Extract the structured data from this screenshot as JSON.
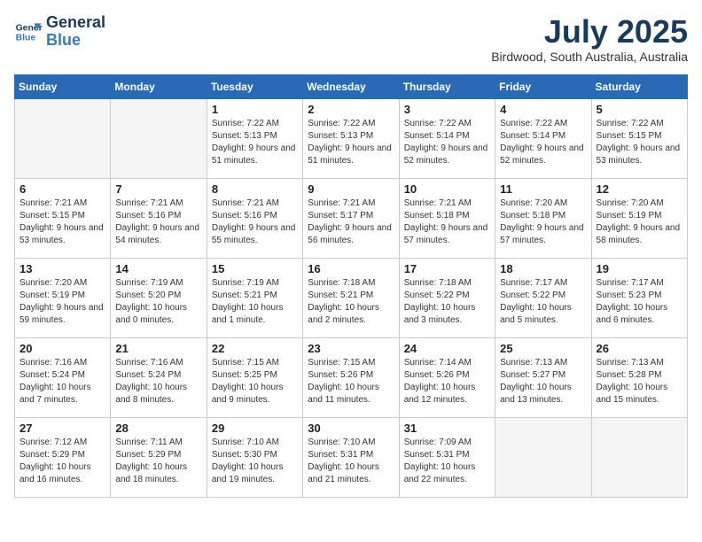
{
  "header": {
    "logo_line1": "General",
    "logo_line2": "Blue",
    "month_title": "July 2025",
    "location": "Birdwood, South Australia, Australia"
  },
  "days_of_week": [
    "Sunday",
    "Monday",
    "Tuesday",
    "Wednesday",
    "Thursday",
    "Friday",
    "Saturday"
  ],
  "weeks": [
    [
      {
        "day": "",
        "content": ""
      },
      {
        "day": "",
        "content": ""
      },
      {
        "day": "1",
        "content": "Sunrise: 7:22 AM\nSunset: 5:13 PM\nDaylight: 9 hours and 51 minutes."
      },
      {
        "day": "2",
        "content": "Sunrise: 7:22 AM\nSunset: 5:13 PM\nDaylight: 9 hours and 51 minutes."
      },
      {
        "day": "3",
        "content": "Sunrise: 7:22 AM\nSunset: 5:14 PM\nDaylight: 9 hours and 52 minutes."
      },
      {
        "day": "4",
        "content": "Sunrise: 7:22 AM\nSunset: 5:14 PM\nDaylight: 9 hours and 52 minutes."
      },
      {
        "day": "5",
        "content": "Sunrise: 7:22 AM\nSunset: 5:15 PM\nDaylight: 9 hours and 53 minutes."
      }
    ],
    [
      {
        "day": "6",
        "content": "Sunrise: 7:21 AM\nSunset: 5:15 PM\nDaylight: 9 hours and 53 minutes."
      },
      {
        "day": "7",
        "content": "Sunrise: 7:21 AM\nSunset: 5:16 PM\nDaylight: 9 hours and 54 minutes."
      },
      {
        "day": "8",
        "content": "Sunrise: 7:21 AM\nSunset: 5:16 PM\nDaylight: 9 hours and 55 minutes."
      },
      {
        "day": "9",
        "content": "Sunrise: 7:21 AM\nSunset: 5:17 PM\nDaylight: 9 hours and 56 minutes."
      },
      {
        "day": "10",
        "content": "Sunrise: 7:21 AM\nSunset: 5:18 PM\nDaylight: 9 hours and 57 minutes."
      },
      {
        "day": "11",
        "content": "Sunrise: 7:20 AM\nSunset: 5:18 PM\nDaylight: 9 hours and 57 minutes."
      },
      {
        "day": "12",
        "content": "Sunrise: 7:20 AM\nSunset: 5:19 PM\nDaylight: 9 hours and 58 minutes."
      }
    ],
    [
      {
        "day": "13",
        "content": "Sunrise: 7:20 AM\nSunset: 5:19 PM\nDaylight: 9 hours and 59 minutes."
      },
      {
        "day": "14",
        "content": "Sunrise: 7:19 AM\nSunset: 5:20 PM\nDaylight: 10 hours and 0 minutes."
      },
      {
        "day": "15",
        "content": "Sunrise: 7:19 AM\nSunset: 5:21 PM\nDaylight: 10 hours and 1 minute."
      },
      {
        "day": "16",
        "content": "Sunrise: 7:18 AM\nSunset: 5:21 PM\nDaylight: 10 hours and 2 minutes."
      },
      {
        "day": "17",
        "content": "Sunrise: 7:18 AM\nSunset: 5:22 PM\nDaylight: 10 hours and 3 minutes."
      },
      {
        "day": "18",
        "content": "Sunrise: 7:17 AM\nSunset: 5:22 PM\nDaylight: 10 hours and 5 minutes."
      },
      {
        "day": "19",
        "content": "Sunrise: 7:17 AM\nSunset: 5:23 PM\nDaylight: 10 hours and 6 minutes."
      }
    ],
    [
      {
        "day": "20",
        "content": "Sunrise: 7:16 AM\nSunset: 5:24 PM\nDaylight: 10 hours and 7 minutes."
      },
      {
        "day": "21",
        "content": "Sunrise: 7:16 AM\nSunset: 5:24 PM\nDaylight: 10 hours and 8 minutes."
      },
      {
        "day": "22",
        "content": "Sunrise: 7:15 AM\nSunset: 5:25 PM\nDaylight: 10 hours and 9 minutes."
      },
      {
        "day": "23",
        "content": "Sunrise: 7:15 AM\nSunset: 5:26 PM\nDaylight: 10 hours and 11 minutes."
      },
      {
        "day": "24",
        "content": "Sunrise: 7:14 AM\nSunset: 5:26 PM\nDaylight: 10 hours and 12 minutes."
      },
      {
        "day": "25",
        "content": "Sunrise: 7:13 AM\nSunset: 5:27 PM\nDaylight: 10 hours and 13 minutes."
      },
      {
        "day": "26",
        "content": "Sunrise: 7:13 AM\nSunset: 5:28 PM\nDaylight: 10 hours and 15 minutes."
      }
    ],
    [
      {
        "day": "27",
        "content": "Sunrise: 7:12 AM\nSunset: 5:29 PM\nDaylight: 10 hours and 16 minutes."
      },
      {
        "day": "28",
        "content": "Sunrise: 7:11 AM\nSunset: 5:29 PM\nDaylight: 10 hours and 18 minutes."
      },
      {
        "day": "29",
        "content": "Sunrise: 7:10 AM\nSunset: 5:30 PM\nDaylight: 10 hours and 19 minutes."
      },
      {
        "day": "30",
        "content": "Sunrise: 7:10 AM\nSunset: 5:31 PM\nDaylight: 10 hours and 21 minutes."
      },
      {
        "day": "31",
        "content": "Sunrise: 7:09 AM\nSunset: 5:31 PM\nDaylight: 10 hours and 22 minutes."
      },
      {
        "day": "",
        "content": ""
      },
      {
        "day": "",
        "content": ""
      }
    ]
  ]
}
